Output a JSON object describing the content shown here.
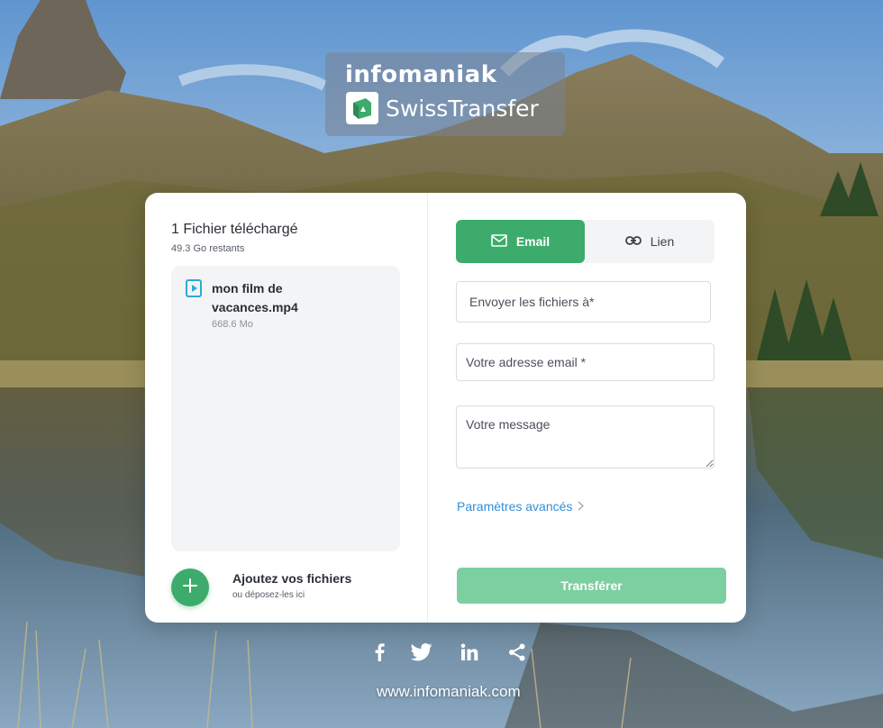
{
  "logo": {
    "brand": "infomaniak",
    "product": "SwissTransfer"
  },
  "upload": {
    "title": "1 Fichier téléchargé",
    "remaining": "49.3 Go restants",
    "files": [
      {
        "name": "mon film de vacances.mp4",
        "size": "668.6 Mo",
        "icon": "video-file-icon"
      }
    ],
    "add_label": "Ajoutez vos fichiers",
    "add_sub": "ou déposez-les ici"
  },
  "tabs": {
    "email": "Email",
    "link": "Lien",
    "active": "email"
  },
  "form": {
    "recipient_placeholder": "Envoyer les fichiers à*",
    "sender_placeholder": "Votre adresse email *",
    "message_placeholder": "Votre message",
    "advanced": "Paramètres avancés",
    "submit": "Transférer"
  },
  "footer": {
    "social": [
      "facebook-icon",
      "twitter-icon",
      "linkedin-icon",
      "share-icon"
    ],
    "site": "www.infomaniak.com"
  },
  "colors": {
    "accent": "#3dab6b",
    "submit_disabled": "#7ccfa0",
    "link": "#2f8fd8"
  }
}
